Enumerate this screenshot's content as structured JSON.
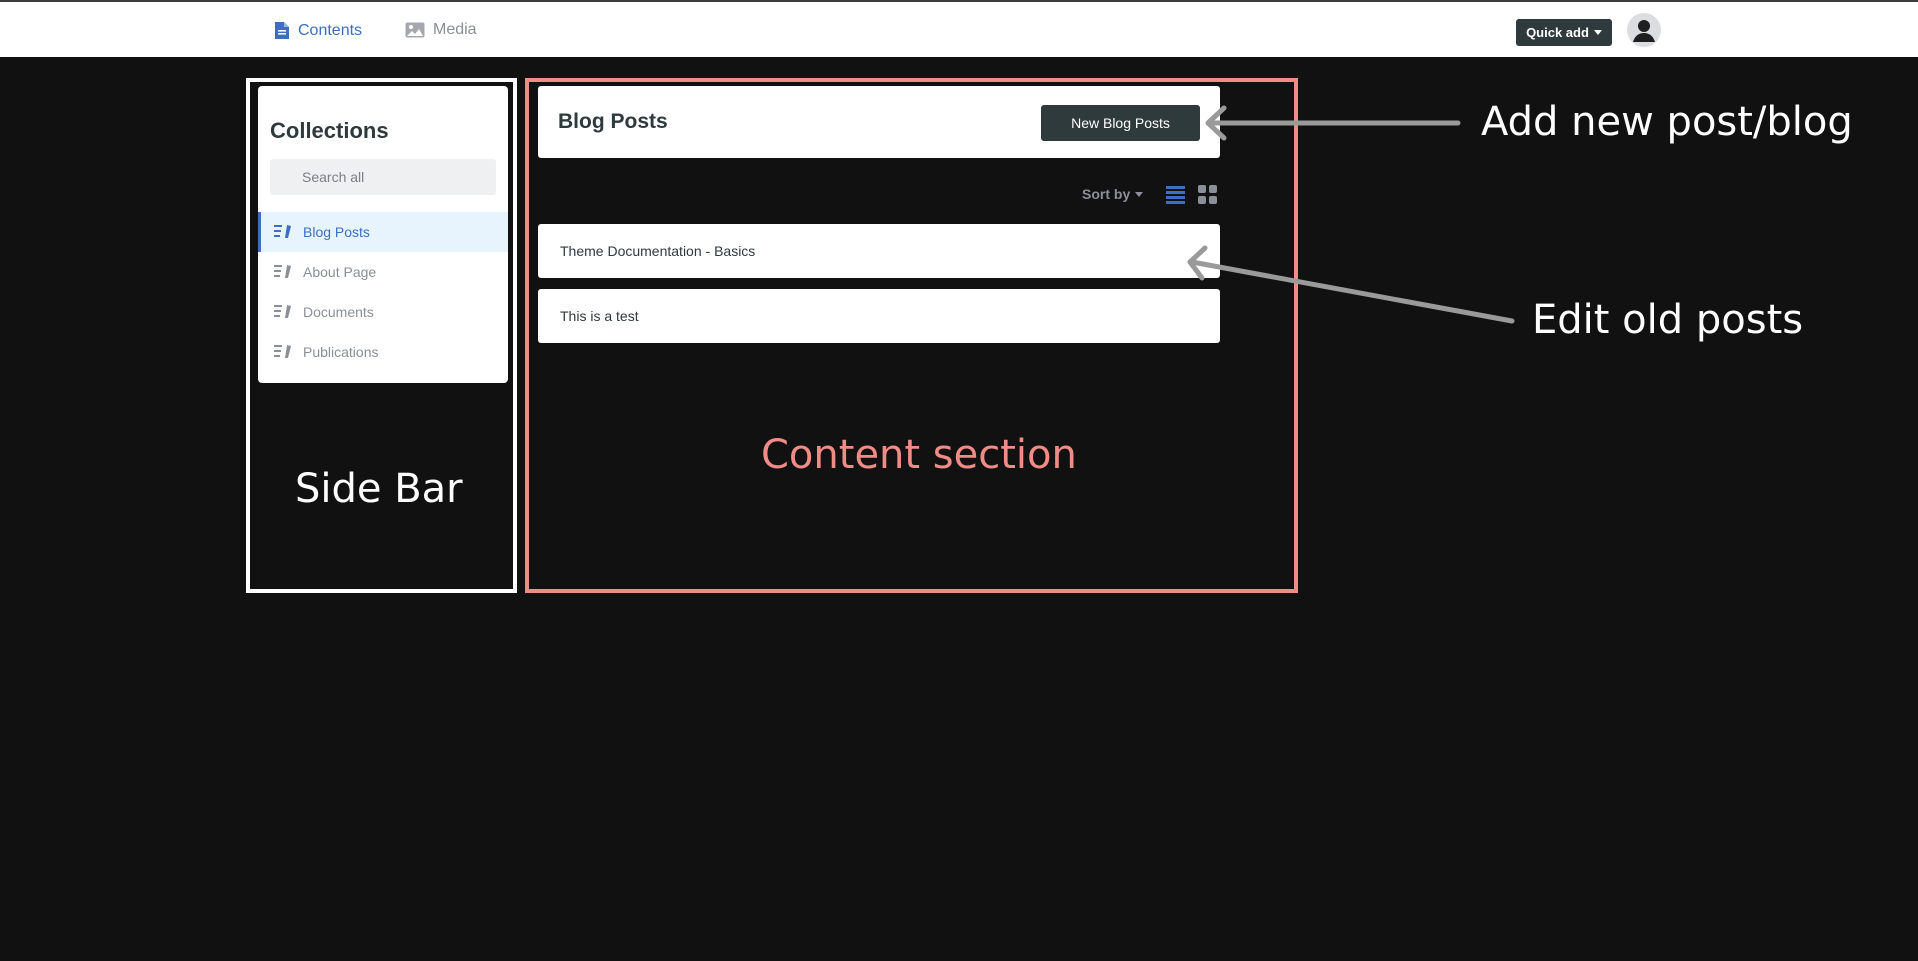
{
  "topbar": {
    "nav": [
      {
        "label": "Contents",
        "icon": "document-icon"
      },
      {
        "label": "Media",
        "icon": "image-icon"
      }
    ],
    "quick_add_label": "Quick add",
    "avatar_icon": "user-avatar-icon"
  },
  "sidebar": {
    "title": "Collections",
    "search_placeholder": "Search all",
    "items": [
      {
        "label": "Blog Posts",
        "active": true
      },
      {
        "label": "About Page",
        "active": false
      },
      {
        "label": "Documents",
        "active": false
      },
      {
        "label": "Publications",
        "active": false
      }
    ],
    "annotation": "Side Bar"
  },
  "content": {
    "title": "Blog Posts",
    "new_button_label": "New Blog Posts",
    "sort_label": "Sort by",
    "posts": [
      {
        "title": "Theme Documentation - Basics"
      },
      {
        "title": "This is a test"
      }
    ],
    "annotation": "Content section"
  },
  "annotations": {
    "add_new": "Add new post/blog",
    "edit_old": "Edit old posts"
  },
  "colors": {
    "accent": "#3a6fc4",
    "dark_button": "#2f3a3d",
    "content_frame": "#f08b86",
    "background": "#121112"
  }
}
